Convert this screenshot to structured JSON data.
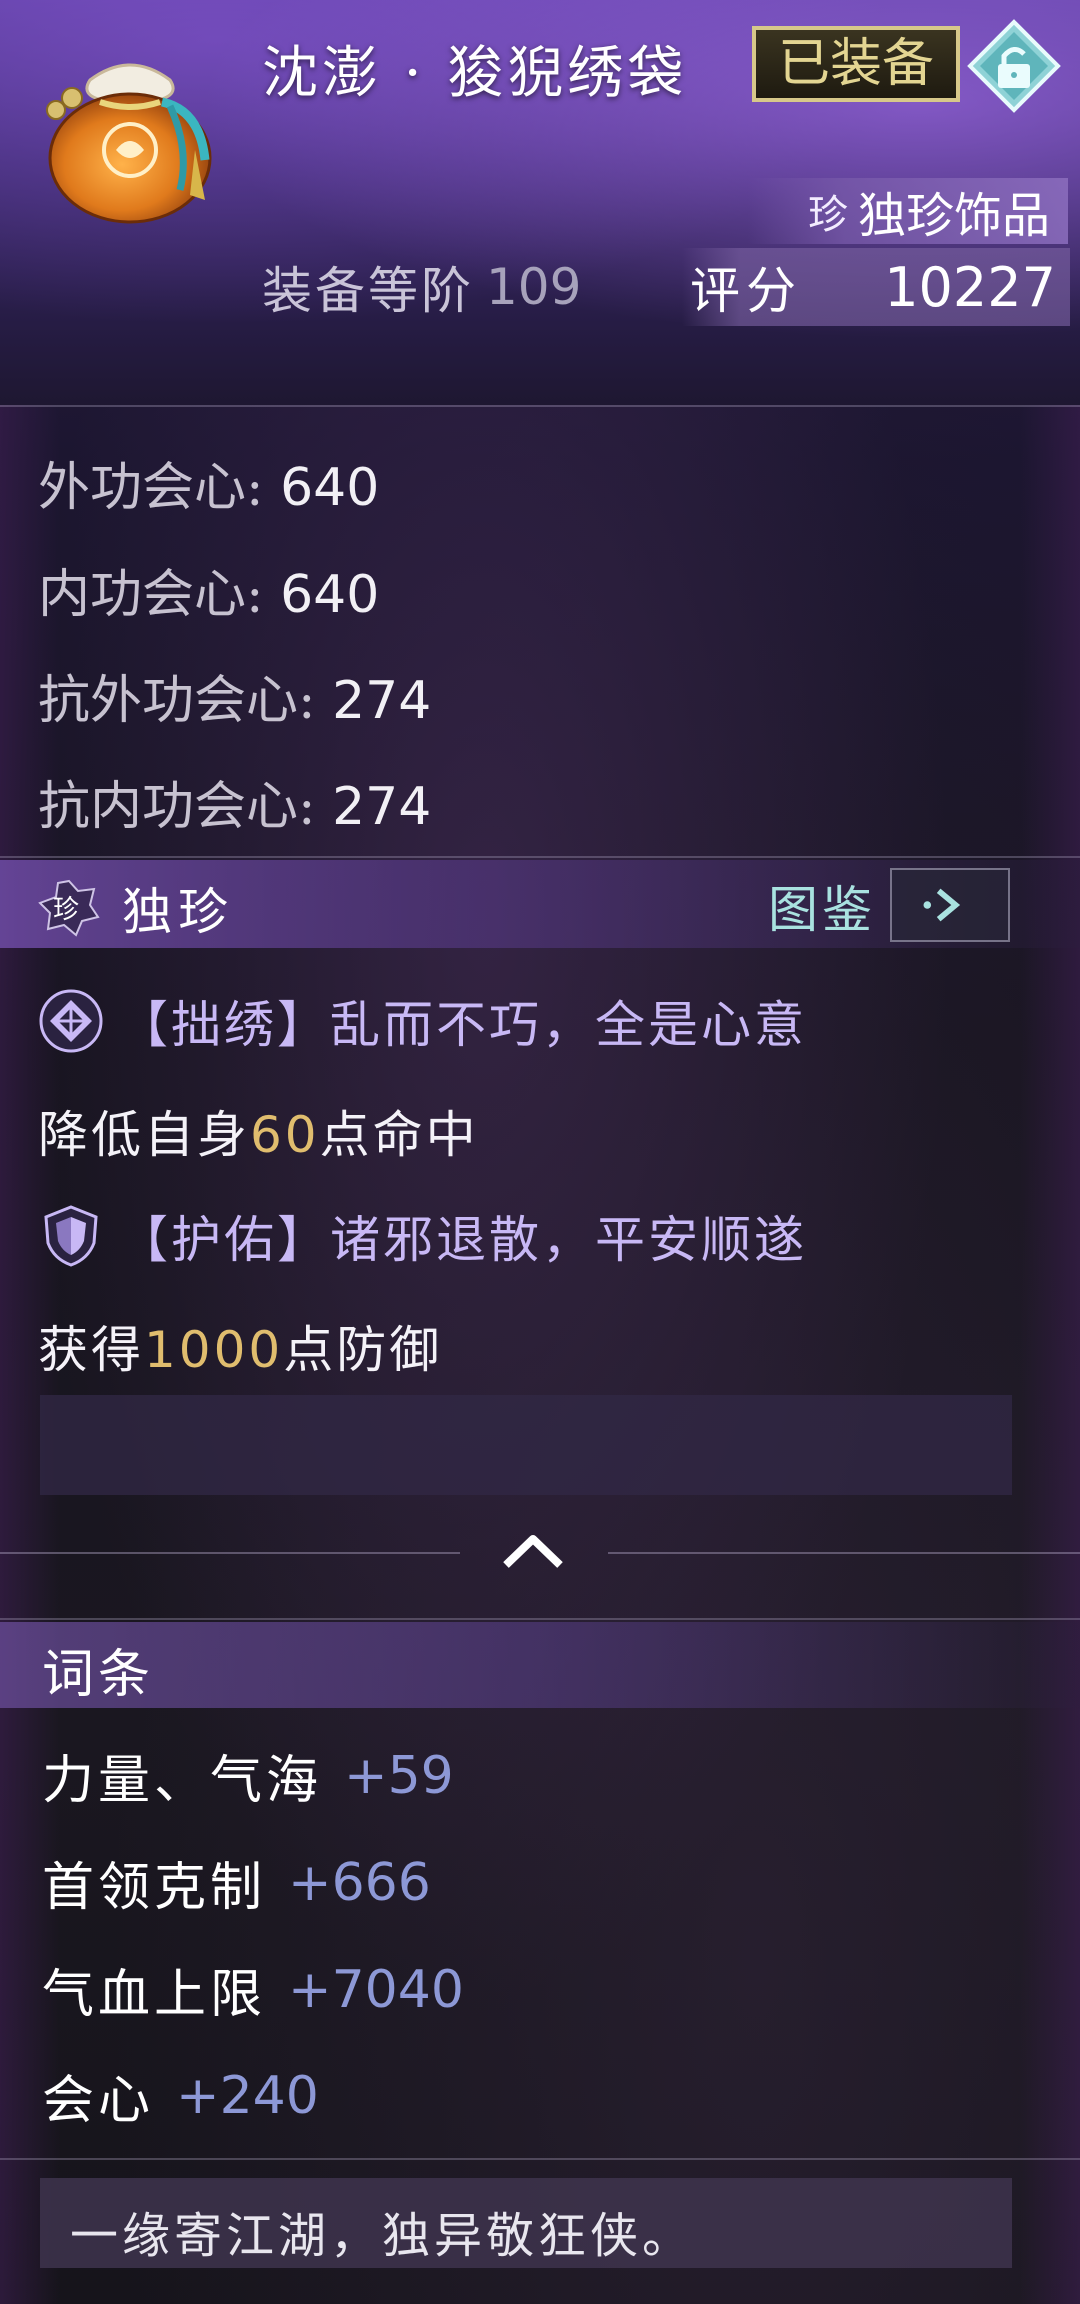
{
  "item": {
    "name": "沈澎 · 狻猊绣袋",
    "equipped_badge": "已装备",
    "rarity_label": "独珍饰品",
    "rarity_gem": "珍",
    "level_label": "装备等阶",
    "level_value": "109",
    "score_label": "评分",
    "score_value": "10227"
  },
  "base_stats": [
    {
      "label": "外功会心:",
      "value": "640"
    },
    {
      "label": "内功会心:",
      "value": "640"
    },
    {
      "label": "抗外功会心:",
      "value": "274"
    },
    {
      "label": "抗内功会心:",
      "value": "274"
    }
  ],
  "unique_section": {
    "gem": "珍",
    "title": "独珍",
    "atlas_label": "图鉴"
  },
  "effects": [
    {
      "icon": "diamond-knot-icon",
      "title": "【拙绣】乱而不巧，全是心意",
      "desc_prefix": "降低自身",
      "desc_number": "60",
      "desc_suffix": "点命中"
    },
    {
      "icon": "shield-icon",
      "title": "【护佑】诸邪退散，平安顺遂",
      "desc_prefix": "获得",
      "desc_number": "1000",
      "desc_suffix": "点防御"
    }
  ],
  "affix_section": {
    "title": "词条",
    "items": [
      {
        "name": "力量、气海",
        "value": "+59"
      },
      {
        "name": "首领克制",
        "value": "+666"
      },
      {
        "name": "气血上限",
        "value": "+7040"
      },
      {
        "name": "会心",
        "value": "+240"
      }
    ]
  },
  "flavor_text": "一缘寄江湖，独异敬狂侠。",
  "colors": {
    "accent_purple": "#7a55b8",
    "highlight_number": "#e0bd6e",
    "affix_value": "#8d98d6",
    "atlas_teal": "#a9e2e0",
    "badge_gold": "#d7c88a"
  }
}
